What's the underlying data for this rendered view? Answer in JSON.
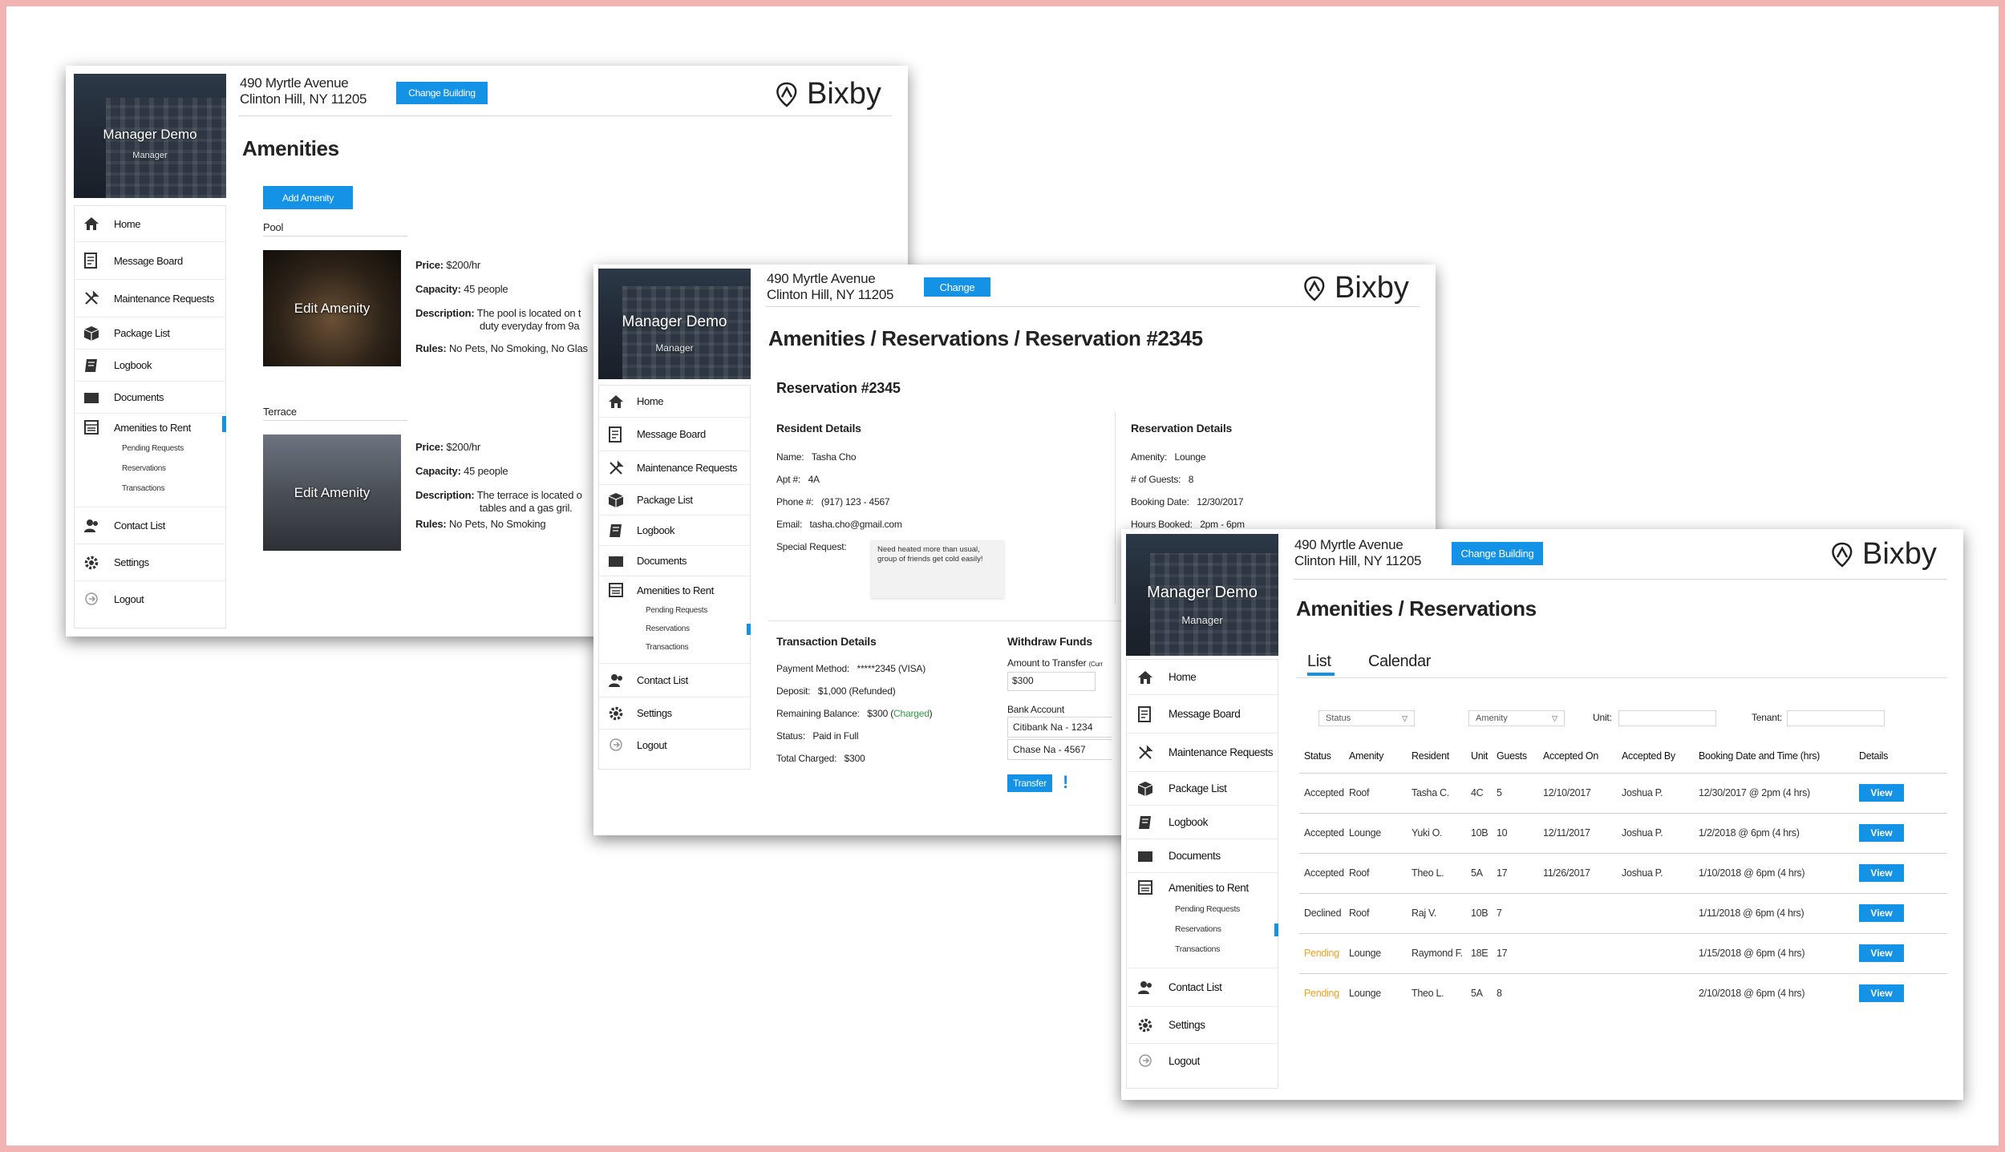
{
  "shared": {
    "address_line1": "490 Myrtle Avenue",
    "address_line2": "Clinton Hill, NY 11205",
    "brand_name": "Bixby",
    "manager_name": "Manager Demo",
    "manager_role": "Manager",
    "accent_color": "#1493e6",
    "nav": [
      {
        "label": "Home",
        "icon": "home-icon"
      },
      {
        "label": "Message Board",
        "icon": "message-board-icon"
      },
      {
        "label": "Maintenance Requests",
        "icon": "tools-icon"
      },
      {
        "label": "Package List",
        "icon": "package-icon"
      },
      {
        "label": "Logbook",
        "icon": "logbook-icon"
      },
      {
        "label": "Documents",
        "icon": "folder-icon"
      },
      {
        "label": "Amenities to Rent",
        "icon": "calendar-icon"
      },
      {
        "label": "Contact List",
        "icon": "contacts-icon"
      },
      {
        "label": "Settings",
        "icon": "gear-icon"
      },
      {
        "label": "Logout",
        "icon": "logout-icon"
      }
    ],
    "nav_sub": [
      "Pending Requests",
      "Reservations",
      "Transactions"
    ]
  },
  "win1": {
    "change_building": "Change Building",
    "page_title": "Amenities",
    "add_amenity": "Add Amenity",
    "amenities": [
      {
        "section": "Pool",
        "edit_label": "Edit Amenity",
        "price_label": "Price:",
        "price": "$200/hr",
        "capacity_label": "Capacity:",
        "capacity": "45 people",
        "description_label": "Description:",
        "description_1": "The pool is located on t",
        "description_2": "duty everyday from 9a",
        "rules_label": "Rules:",
        "rules": "No Pets, No Smoking, No Glas"
      },
      {
        "section": "Terrace",
        "edit_label": "Edit Amenity",
        "price_label": "Price:",
        "price": "$200/hr",
        "capacity_label": "Capacity:",
        "capacity": "45 people",
        "description_label": "Description:",
        "description_1": "The terrace is located o",
        "description_2": "tables and a gas gril.",
        "rules_label": "Rules:",
        "rules": "No Pets, No Smoking"
      }
    ]
  },
  "win2": {
    "change_building": "Change",
    "page_title": "Amenities / Reservations / Reservation #2345",
    "reservation_heading": "Reservation #2345",
    "resident_heading": "Resident Details",
    "resident": {
      "name_label": "Name:",
      "name": "Tasha Cho",
      "apt_label": "Apt #:",
      "apt": "4A",
      "phone_label": "Phone #:",
      "phone": "(917) 123 - 4567",
      "email_label": "Email:",
      "email": "tasha.cho@gmail.com",
      "special_label": "Special Request:",
      "special_text": "Need heated more than usual, group of friends get cold easily!"
    },
    "reservation_details_heading": "Reservation Details",
    "reservation": {
      "amenity_label": "Amenity:",
      "amenity": "Lounge",
      "guests_label": "# of Guests:",
      "guests": "8",
      "date_label": "Booking Date:",
      "date": "12/30/2017",
      "hours_label": "Hours Booked:",
      "hours": "2pm - 6pm"
    },
    "transaction_heading": "Transaction Details",
    "transaction": {
      "method_label": "Payment Method:",
      "method": "*****2345 (VISA)",
      "deposit_label": "Deposit:",
      "deposit": "$1,000 (Refunded)",
      "remaining_label": "Remaining Balance:",
      "remaining": "$300 (",
      "remaining_status": "Charged",
      "remaining_close": ")",
      "status_label": "Status:",
      "status": "Paid in Full",
      "total_label": "Total Charged:",
      "total": "$300"
    },
    "withdraw_heading": "Withdraw Funds",
    "withdraw": {
      "amount_label": "Amount to Transfer",
      "amount_note": "(Curr",
      "amount_value": "$300",
      "bank_label": "Bank Account",
      "banks": [
        "Citibank Na - 1234",
        "Chase Na - 4567"
      ],
      "transfer": "Transfer",
      "charged_color": "#2e9c3f"
    }
  },
  "win3": {
    "change_building": "Change Building",
    "page_title": "Amenities / Reservations",
    "tabs": [
      "List",
      "Calendar"
    ],
    "active_tab": "List",
    "filters": {
      "status_placeholder": "Status",
      "amenity_placeholder": "Amenity",
      "unit_label": "Unit:",
      "tenant_label": "Tenant:"
    },
    "columns": [
      "Status",
      "Amenity",
      "Resident",
      "Unit",
      "Guests",
      "Accepted On",
      "Accepted By",
      "Booking Date and Time (hrs)",
      "Details"
    ],
    "pending_color": "#f0a020",
    "rows": [
      {
        "status": "Accepted",
        "amenity": "Roof",
        "resident": "Tasha C.",
        "unit": "4C",
        "guests": "5",
        "accepted_on": "12/10/2017",
        "accepted_by": "Joshua P.",
        "booking": "12/30/2017 @ 2pm (4 hrs)",
        "details": "View"
      },
      {
        "status": "Accepted",
        "amenity": "Lounge",
        "resident": "Yuki O.",
        "unit": "10B",
        "guests": "10",
        "accepted_on": "12/11/2017",
        "accepted_by": "Joshua P.",
        "booking": "1/2/2018 @ 6pm (4 hrs)",
        "details": "View"
      },
      {
        "status": "Accepted",
        "amenity": "Roof",
        "resident": "Theo L.",
        "unit": "5A",
        "guests": "17",
        "accepted_on": "11/26/2017",
        "accepted_by": "Joshua P.",
        "booking": "1/10/2018 @ 6pm (4 hrs)",
        "details": "View"
      },
      {
        "status": "Declined",
        "amenity": "Roof",
        "resident": "Raj V.",
        "unit": "10B",
        "guests": "7",
        "accepted_on": "",
        "accepted_by": "",
        "booking": "1/11/2018 @ 6pm (4 hrs)",
        "details": "View"
      },
      {
        "status": "Pending",
        "amenity": "Lounge",
        "resident": "Raymond F.",
        "unit": "18E",
        "guests": "17",
        "accepted_on": "",
        "accepted_by": "",
        "booking": "1/15/2018 @ 6pm (4 hrs)",
        "details": "View"
      },
      {
        "status": "Pending",
        "amenity": "Lounge",
        "resident": "Theo L.",
        "unit": "5A",
        "guests": "8",
        "accepted_on": "",
        "accepted_by": "",
        "booking": "2/10/2018 @ 6pm (4 hrs)",
        "details": "View"
      }
    ]
  }
}
